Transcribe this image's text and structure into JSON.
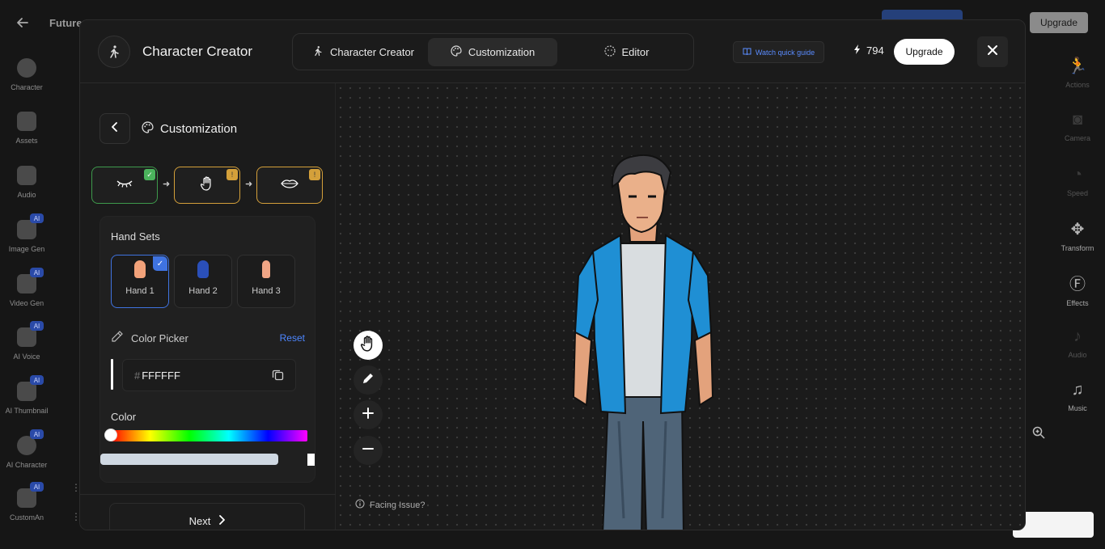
{
  "background_app": {
    "title": "Future",
    "upgrade_label": "Upgrade",
    "left_rail": [
      {
        "label": "Character",
        "icon": "character-icon",
        "ai": false
      },
      {
        "label": "Assets",
        "icon": "assets-icon",
        "ai": false
      },
      {
        "label": "Audio",
        "icon": "audio-icon",
        "ai": false
      },
      {
        "label": "Image Gen",
        "icon": "image-gen-icon",
        "ai": true
      },
      {
        "label": "Video Gen",
        "icon": "video-gen-icon",
        "ai": true
      },
      {
        "label": "AI Voice",
        "icon": "ai-voice-icon",
        "ai": true
      },
      {
        "label": "AI Thumbnail",
        "icon": "ai-thumbnail-icon",
        "ai": true
      },
      {
        "label": "AI Character",
        "icon": "ai-character-icon",
        "ai": true
      },
      {
        "label": "CustomAn",
        "icon": "custom-animation-icon",
        "ai": true
      }
    ],
    "ai_badge": "AI",
    "right_rail": [
      {
        "label": "Actions",
        "icon": "actions-icon",
        "bright": false
      },
      {
        "label": "Camera",
        "icon": "camera-icon",
        "bright": false
      },
      {
        "label": "Speed",
        "icon": "speed-icon",
        "bright": false
      },
      {
        "label": "Transform",
        "icon": "transform-icon",
        "bright": true
      },
      {
        "label": "Effects",
        "icon": "effects-icon",
        "bright": true
      },
      {
        "label": "Audio",
        "icon": "audio-icon",
        "bright": false
      },
      {
        "label": "Music",
        "icon": "music-icon",
        "bright": true
      }
    ]
  },
  "modal": {
    "title": "Character Creator",
    "tabs": [
      {
        "label": "Character Creator",
        "icon": "running-person-icon",
        "active": false
      },
      {
        "label": "Customization",
        "icon": "palette-icon",
        "active": true
      },
      {
        "label": "Editor",
        "icon": "editor-icon",
        "active": false
      }
    ],
    "watch_guide_label": "Watch quick guide",
    "credits": "794",
    "upgrade_label": "Upgrade"
  },
  "panel": {
    "title": "Customization",
    "steps": [
      {
        "icon": "eye-closed-icon",
        "status": "done"
      },
      {
        "icon": "hand-icon",
        "status": "pending"
      },
      {
        "icon": "lips-icon",
        "status": "pending"
      }
    ],
    "hand_sets_title": "Hand Sets",
    "hands": [
      {
        "label": "Hand 1",
        "color": "#f2a27a",
        "selected": true
      },
      {
        "label": "Hand 2",
        "color": "#2a4fb8",
        "selected": false
      },
      {
        "label": "Hand 3",
        "color": "#f0a585",
        "selected": false
      }
    ],
    "color_picker_label": "Color Picker",
    "reset_label": "Reset",
    "hex_prefix": "#",
    "hex_value": "FFFFFF",
    "color_label": "Color",
    "next_label": "Next"
  },
  "canvas": {
    "tools": [
      "hand-pan-icon",
      "pencil-icon",
      "zoom-in-icon",
      "zoom-out-icon"
    ],
    "facing_issue": "Facing Issue?"
  },
  "colors": {
    "accent_blue": "#4d86ff",
    "done_green": "#3e9a4c",
    "pending_gold": "#d4a03a",
    "jacket_blue": "#1f8fd4"
  }
}
